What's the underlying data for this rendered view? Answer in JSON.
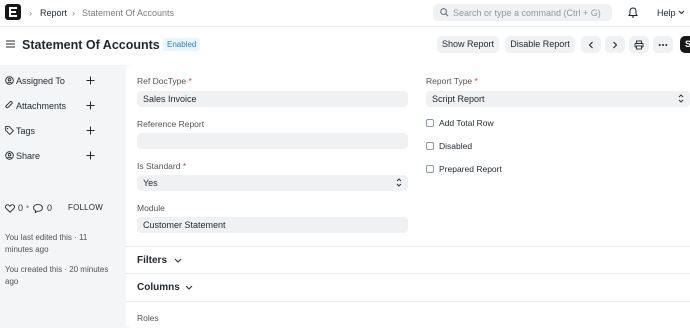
{
  "navbar": {
    "logo_letter": "E",
    "breadcrumbs": [
      "Report",
      "Statement Of Accounts"
    ],
    "search_placeholder": "Search or type a command (Ctrl + G)",
    "help_label": "Help"
  },
  "page": {
    "title": "Statement Of Accounts",
    "status_badge": "Enabled",
    "actions": {
      "show_report": "Show Report",
      "disable_report": "Disable Report",
      "save_initial": "S"
    }
  },
  "sidebar": {
    "items": [
      {
        "label": "Assigned To",
        "icon": "assign-icon"
      },
      {
        "label": "Attachments",
        "icon": "paperclip-icon"
      },
      {
        "label": "Tags",
        "icon": "tag-icon"
      },
      {
        "label": "Share",
        "icon": "share-icon"
      }
    ],
    "likes": "0",
    "comments": "0",
    "follow": "FOLLOW",
    "last_edited": "You last edited this · 11 minutes ago",
    "created": "You created this · 20 minutes ago"
  },
  "form": {
    "ref_doctype": {
      "label": "Ref DocType",
      "value": "Sales Invoice"
    },
    "reference_report": {
      "label": "Reference Report",
      "value": ""
    },
    "is_standard": {
      "label": "Is Standard",
      "value": "Yes"
    },
    "module": {
      "label": "Module",
      "value": "Customer Statement"
    },
    "report_type": {
      "label": "Report Type",
      "value": "Script Report"
    },
    "checks": [
      {
        "label": "Add Total Row",
        "checked": false
      },
      {
        "label": "Disabled",
        "checked": false
      },
      {
        "label": "Prepared Report",
        "checked": false
      }
    ]
  },
  "sections": {
    "filters": "Filters",
    "columns": "Columns",
    "roles": "Roles"
  },
  "colors": {
    "badge_bg": "#e9f6fd",
    "badge_text": "#2b80c4",
    "required": "#e03636"
  }
}
